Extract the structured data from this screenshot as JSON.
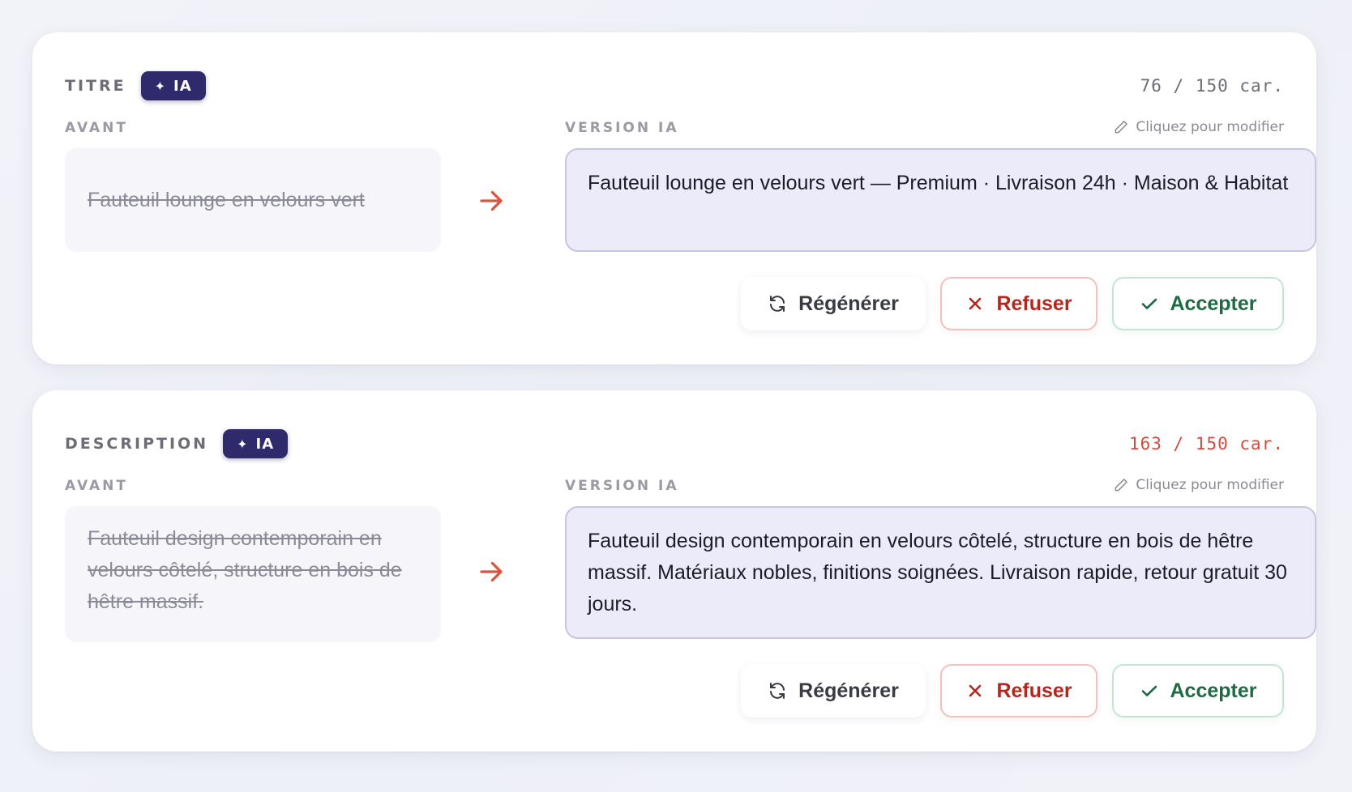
{
  "fields": [
    {
      "name": "TITRE",
      "badge": "IA",
      "counter": "76 / 150 car.",
      "before_label": "AVANT",
      "ia_label": "VERSION IA",
      "edit_hint": "Cliquez pour modifier",
      "before_text": "Fauteuil lounge en velours vert",
      "ia_text": "Fauteuil lounge en velours vert — Premium · Livraison 24h · Maison & Habitat",
      "actions": {
        "regenerate": "Régénérer",
        "refuse": "Refuser",
        "accept": "Accepter"
      }
    },
    {
      "name": "DESCRIPTION",
      "badge": "IA",
      "counter": "163 / 150 car.",
      "counter_over_limit": true,
      "before_label": "AVANT",
      "ia_label": "VERSION IA",
      "edit_hint": "Cliquez pour modifier",
      "before_text": "Fauteuil design contemporain en velours côtelé, structure en bois de hêtre massif.",
      "ia_text": "Fauteuil design contemporain en velours côtelé, structure en bois de hêtre massif. Matériaux nobles, finitions soignées. Livraison rapide, retour gratuit 30 jours.",
      "actions": {
        "regenerate": "Régénérer",
        "refuse": "Refuser",
        "accept": "Accepter"
      }
    }
  ],
  "icons": {
    "badge": "sparkle-icon",
    "edit": "pencil-icon",
    "arrow": "arrow-right-icon",
    "regenerate": "refresh-icon",
    "refuse": "close-icon",
    "accept": "check-icon"
  },
  "colors": {
    "badge_bg": "#2e2a6b",
    "arrow": "#d9553f",
    "over_limit": "#d24a3c",
    "ia_box_bg": "#ecebfa",
    "refuse": "#b5261d",
    "accept": "#1f6a44"
  }
}
